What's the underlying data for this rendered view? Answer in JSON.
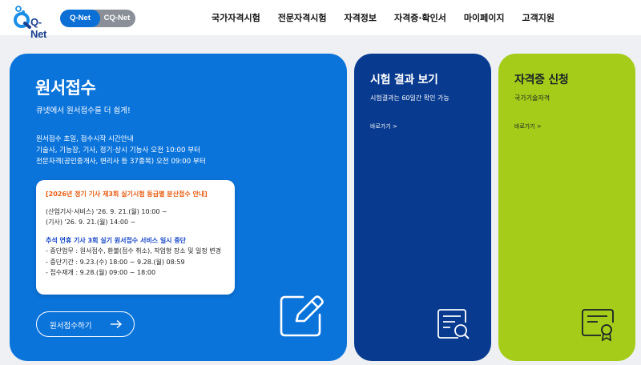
{
  "header": {
    "logo_text": "Q-Net",
    "switch": {
      "active": "Q-Net",
      "other": "CQ-Net"
    },
    "nav": [
      "국가자격시험",
      "전문자격시험",
      "자격정보",
      "자격증·확인서",
      "마이페이지",
      "고객지원"
    ]
  },
  "main_card": {
    "title": "원서접수",
    "subtitle": "큐넷에서 원서접수를 더 쉽게!",
    "info": [
      "원서접수 초일, 접수시작 시간안내",
      "기술사, 기능장, 기사, 정기·상시 기능사 오전 10:00 부터",
      "전문자격(공인중개사, 변리사 등 37종목) 오전 09:00 부터"
    ],
    "notice": {
      "title": "[2026년 정기 기사 제3회 실기시험 등급별 분산접수 안내]",
      "schedule": [
        "(산업기사·서비스) '26. 9. 21.(월) 10:00 ~",
        "(기사) '26. 9. 21.(월) 14:00 ~"
      ],
      "subtitle": "추석 연휴 기사 3회 실기 원서접수 서비스 일시 중단",
      "details": [
        "- 중단업무 : 원서접수, 환불(접수 취소), 작업형 장소 및 일정 변경",
        "- 중단기간 : 9.23.(수) 18:00 ~ 9.28.(월) 08:59",
        "- 접수재개 : 9.28.(월) 09:00 ~ 18:00"
      ]
    },
    "button_label": "원서접수하기",
    "icon": "edit-icon"
  },
  "result_card": {
    "title": "시험 결과 보기",
    "subtitle": "시험결과는 60일간 확인 가능",
    "link": "바로가기 >",
    "icon": "document-search-icon"
  },
  "cert_card": {
    "title": "자격증 신청",
    "subtitle": "국가기술자격",
    "link": "바로가기 >",
    "icon": "certificate-icon"
  },
  "colors": {
    "main_blue": "#0b74db",
    "navy": "#083b8f",
    "lime": "#a4cc18",
    "notice_orange": "#e85d12",
    "notice_blue": "#1848c8"
  }
}
